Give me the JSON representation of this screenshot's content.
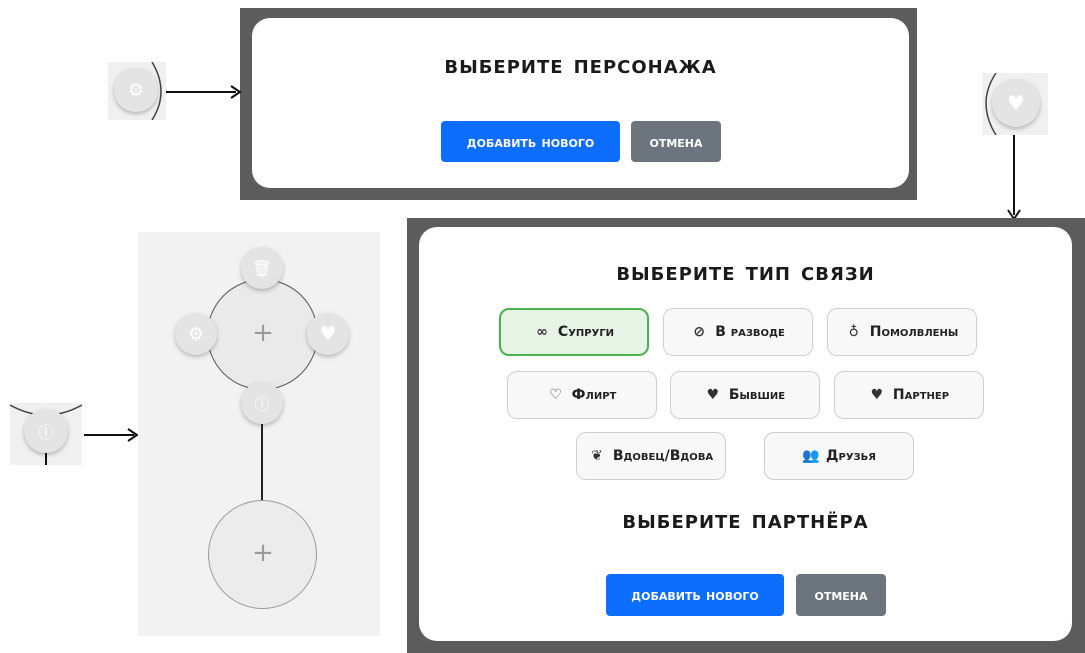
{
  "dialog_character": {
    "title": "Выберите персонажа",
    "add_button": "Добавить нового",
    "cancel_button": "Отмена"
  },
  "dialog_relation": {
    "title": "Выберите тип связи",
    "partner_title": "Выберите партнёра",
    "add_button": "Добавить нового",
    "cancel_button": "Отмена",
    "options": [
      {
        "label": "Супруги",
        "icon": "rings-icon",
        "glyph": "∞",
        "selected": true
      },
      {
        "label": "В разводе",
        "icon": "broken-ring-icon",
        "glyph": "⊘",
        "selected": false
      },
      {
        "label": "Помолвлены",
        "icon": "ring-icon",
        "glyph": "♁",
        "selected": false
      },
      {
        "label": "Флирт",
        "icon": "chat-heart-icon",
        "glyph": "♡",
        "selected": false
      },
      {
        "label": "Бывшие",
        "icon": "broken-heart-icon",
        "glyph": "♥",
        "selected": false
      },
      {
        "label": "Партнер",
        "icon": "heart-icon",
        "glyph": "♥",
        "selected": false
      },
      {
        "label": "Вдовец/Вдова",
        "icon": "feather-icon",
        "glyph": "❦",
        "selected": false
      },
      {
        "label": "Друзья",
        "icon": "users-icon",
        "glyph": "👥",
        "selected": false
      }
    ]
  },
  "node": {
    "add_glyph": "+",
    "top_icon": "trash-icon",
    "left_icon": "gear-icon",
    "right_icon": "heart-icon",
    "bottom_icon": "info-icon"
  },
  "colors": {
    "primary": "#0d6efd",
    "secondary": "#6c757d",
    "selected_border": "#4caf50",
    "selected_bg": "#e6f4e6"
  }
}
